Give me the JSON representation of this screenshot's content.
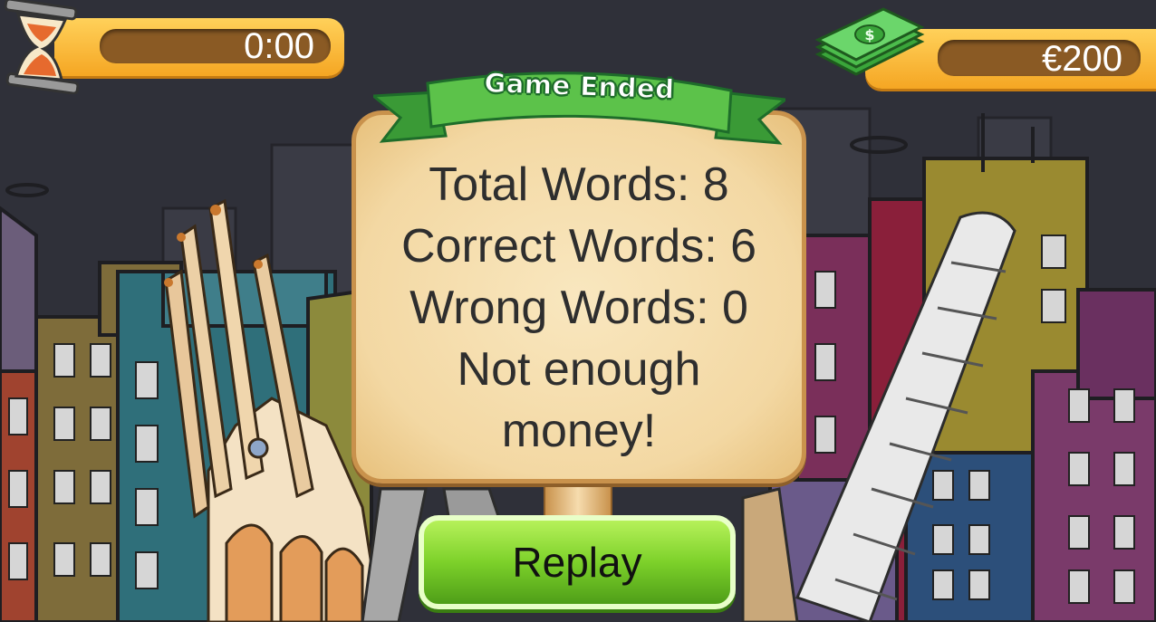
{
  "hud": {
    "timer": "0:00",
    "money": "€200",
    "timer_icon": "hourglass-icon",
    "money_icon": "cash-stack-icon"
  },
  "dialog": {
    "title": "Game Ended",
    "lines": [
      "Total Words: 8",
      "Correct Words: 6",
      "Wrong Words: 0",
      "Not enough",
      "money!"
    ]
  },
  "buttons": {
    "replay": "Replay"
  },
  "colors": {
    "hud_bar": "#f5a623",
    "hud_inner": "#8a5a24",
    "ribbon": "#4fb83a",
    "panel": "#f3d8a3",
    "replay_button": "#7dd12a"
  }
}
